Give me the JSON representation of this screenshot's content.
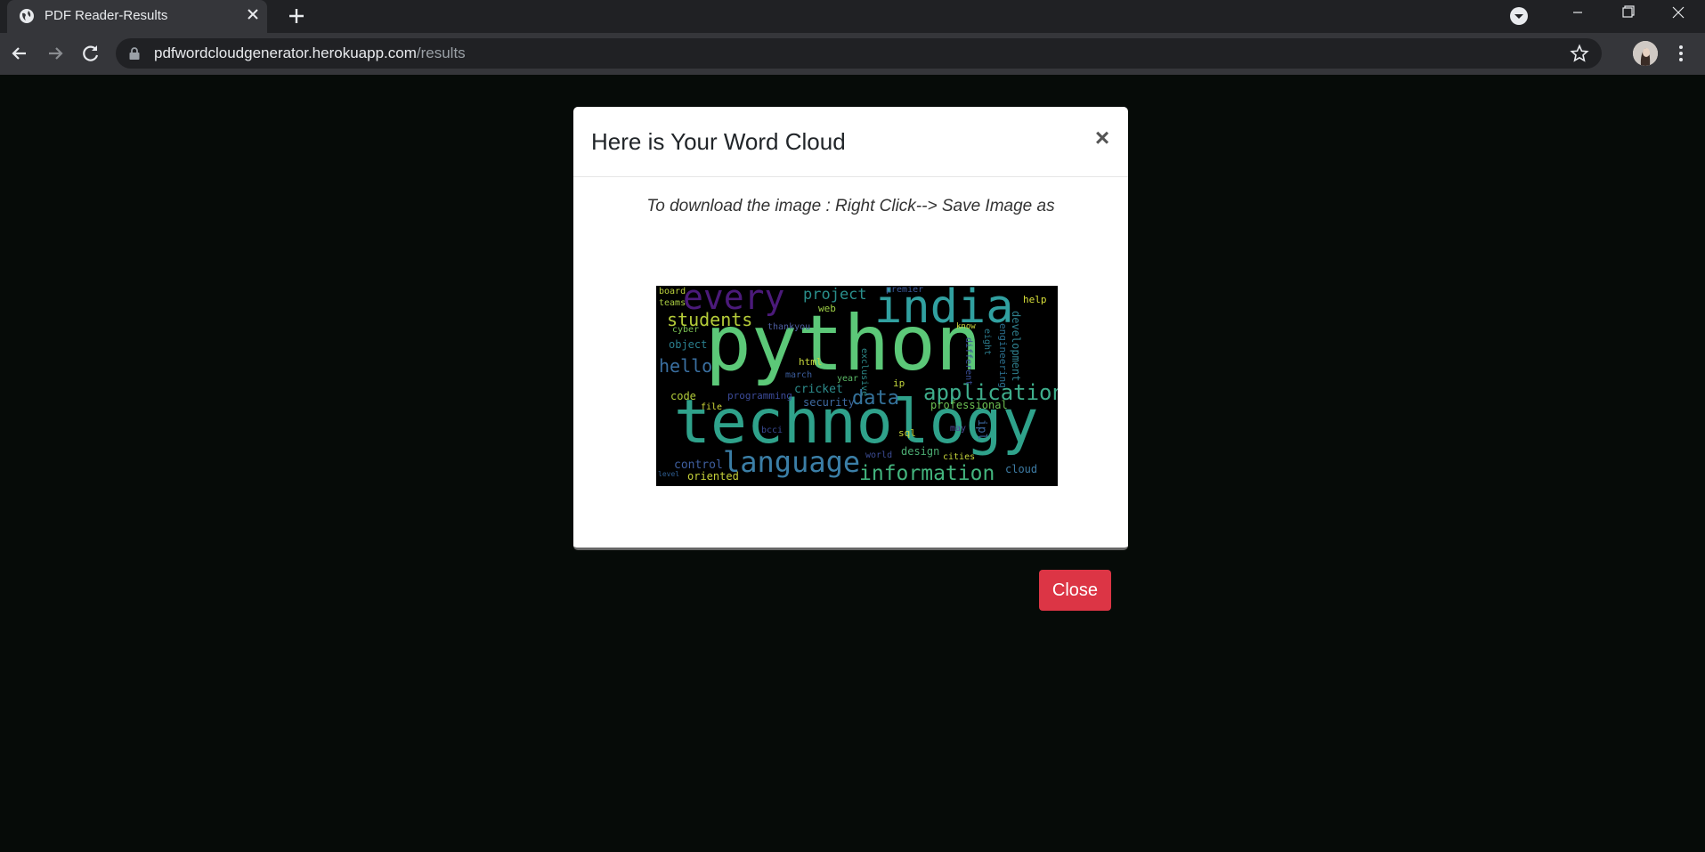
{
  "browser": {
    "tab_title": "PDF Reader-Results",
    "url_domain": "pdfwordcloudgenerator.herokuapp.com",
    "url_path": "/results"
  },
  "modal": {
    "title": "Here is Your Word Cloud",
    "close_symbol": "×",
    "hint": "To download the image : Right Click--> Save Image as",
    "close_button": "Close"
  },
  "wordcloud": {
    "words": [
      {
        "text": "python",
        "color": "#5cc878"
      },
      {
        "text": "technology",
        "color": "#2fa28b"
      },
      {
        "text": "india",
        "color": "#31a0a0"
      },
      {
        "text": "every",
        "color": "#4b1a7a"
      },
      {
        "text": "students",
        "color": "#b5cc39"
      },
      {
        "text": "project",
        "color": "#2a8f8c"
      },
      {
        "text": "application",
        "color": "#3fae8c"
      },
      {
        "text": "language",
        "color": "#3b7ea6"
      },
      {
        "text": "information",
        "color": "#43b57e"
      },
      {
        "text": "data",
        "color": "#35739c"
      },
      {
        "text": "hello",
        "color": "#3a6fa0"
      },
      {
        "text": "cricket",
        "color": "#2d8c8c"
      },
      {
        "text": "security",
        "color": "#3e6aa0"
      },
      {
        "text": "professional",
        "color": "#6cc052"
      },
      {
        "text": "programming",
        "color": "#3c4b9a"
      },
      {
        "text": "control",
        "color": "#3f5fa0"
      },
      {
        "text": "oriented",
        "color": "#c7d23a"
      },
      {
        "text": "cloud",
        "color": "#3e7ca5"
      },
      {
        "text": "design",
        "color": "#4cae74"
      },
      {
        "text": "object",
        "color": "#2a7f8e"
      },
      {
        "text": "web",
        "color": "#9fd046"
      },
      {
        "text": "code",
        "color": "#b2cc3a"
      },
      {
        "text": "html",
        "color": "#c8d83c"
      },
      {
        "text": "help",
        "color": "#d8e03a"
      },
      {
        "text": "sql",
        "color": "#c9d93c"
      },
      {
        "text": "file",
        "color": "#d4dd3a"
      },
      {
        "text": "development",
        "color": "#2e7f8d"
      },
      {
        "text": "engineering",
        "color": "#2b6f8f"
      },
      {
        "text": "march",
        "color": "#3b5d9c"
      },
      {
        "text": "exclusive",
        "color": "#2e8a8a"
      },
      {
        "text": "different",
        "color": "#3a4f98"
      },
      {
        "text": "year",
        "color": "#5bba67"
      },
      {
        "text": "world",
        "color": "#3d4d96"
      },
      {
        "text": "cities",
        "color": "#c7d63b"
      },
      {
        "text": "board",
        "color": "#b9cf3b"
      },
      {
        "text": "teams",
        "color": "#aacd42"
      },
      {
        "text": "cyber",
        "color": "#7bc153"
      },
      {
        "text": "thankyou",
        "color": "#4c5c9f"
      },
      {
        "text": "eight",
        "color": "#2c7d8e"
      },
      {
        "text": "ipl",
        "color": "#3c6aa0"
      },
      {
        "text": "may",
        "color": "#4f4a98"
      },
      {
        "text": "bcci",
        "color": "#3a4b94"
      },
      {
        "text": "premier",
        "color": "#3c5a9a"
      },
      {
        "text": "know",
        "color": "#cad63c"
      },
      {
        "text": "ip",
        "color": "#c2d53c"
      },
      {
        "text": "level",
        "color": "#2f5e92"
      }
    ]
  }
}
